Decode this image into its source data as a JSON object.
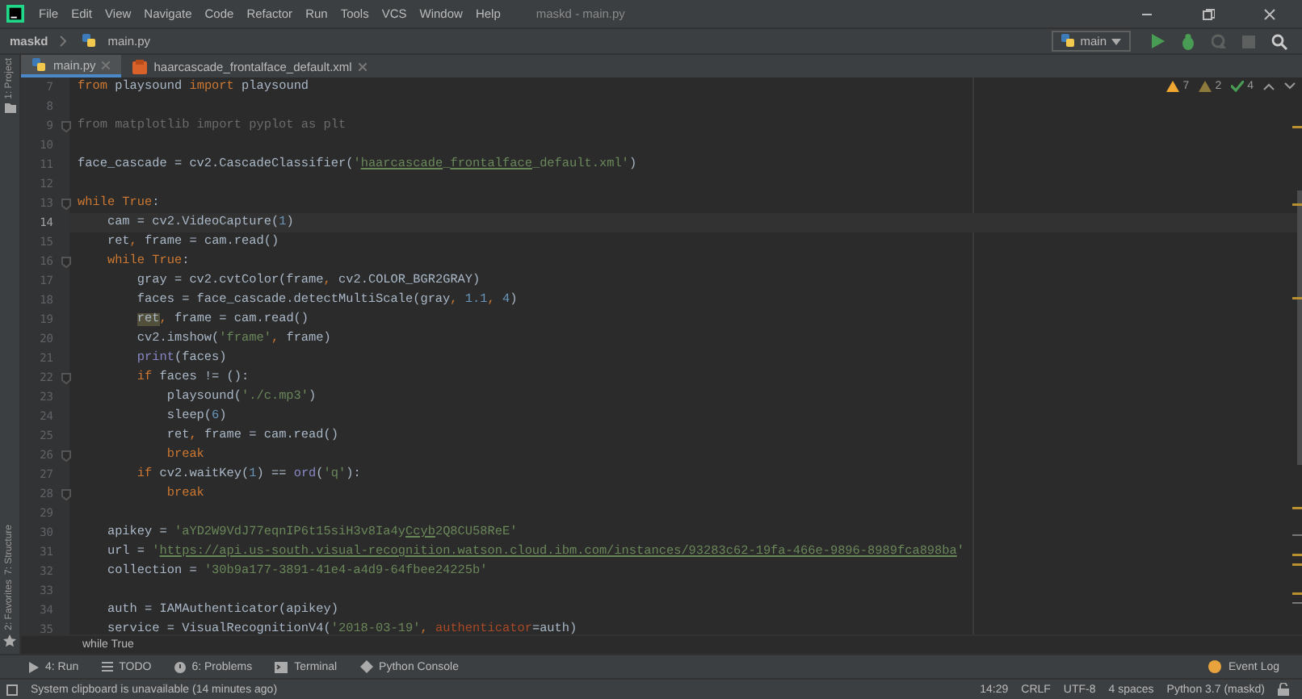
{
  "window": {
    "title": "maskd - main.py",
    "menu": [
      "File",
      "Edit",
      "View",
      "Navigate",
      "Code",
      "Refactor",
      "Run",
      "Tools",
      "VCS",
      "Window",
      "Help"
    ]
  },
  "navbar": {
    "project": "maskd",
    "file": "main.py",
    "run_config": "main"
  },
  "tabs": [
    {
      "label": "main.py",
      "kind": "python",
      "selected": true
    },
    {
      "label": "haarcascade_frontalface_default.xml",
      "kind": "xml",
      "selected": false
    }
  ],
  "side_tools": {
    "top": [
      "1: Project"
    ],
    "bottom": [
      "7: Structure",
      "2: Favorites"
    ]
  },
  "inspections": [
    {
      "kind": "warning",
      "count": "7"
    },
    {
      "kind": "weak",
      "count": "2"
    },
    {
      "kind": "typo",
      "count": "4"
    }
  ],
  "editor": {
    "lines": [
      {
        "number": "7",
        "fold": false,
        "current": false,
        "tokens": [
          {
            "kind": "kw",
            "text": "from"
          },
          {
            "kind": "p",
            "text": " playsound "
          },
          {
            "kind": "kw",
            "text": "import"
          },
          {
            "kind": "p",
            "text": " playsound"
          }
        ]
      },
      {
        "number": "8",
        "fold": false,
        "current": false
      },
      {
        "number": "9",
        "fold": true,
        "current": false,
        "tokens": [
          {
            "kind": "u",
            "text": "from matplotlib import pyplot as plt"
          }
        ]
      },
      {
        "number": "10",
        "fold": false,
        "current": false
      },
      {
        "number": "11",
        "fold": false,
        "current": false,
        "tokens": [
          {
            "kind": "p",
            "text": "face_cascade = cv2.CascadeClassifier("
          },
          {
            "kind": "s",
            "text": "'"
          },
          {
            "kind": "su",
            "text": "haarcascade"
          },
          {
            "kind": "s",
            "text": "_"
          },
          {
            "kind": "su",
            "text": "frontalface"
          },
          {
            "kind": "s",
            "text": "_default.xml'"
          },
          {
            "kind": "p",
            "text": ")"
          }
        ]
      },
      {
        "number": "12",
        "fold": false,
        "current": false
      },
      {
        "number": "13",
        "fold": true,
        "current": false,
        "tokens": [
          {
            "kind": "kw",
            "text": "while True"
          },
          {
            "kind": "p",
            "text": ":"
          }
        ]
      },
      {
        "number": "14",
        "fold": false,
        "current": true,
        "tokens": [
          {
            "kind": "p",
            "text": "    cam = cv2.VideoCapture("
          },
          {
            "kind": "n",
            "text": "1"
          },
          {
            "kind": "p",
            "text": ")"
          }
        ]
      },
      {
        "number": "15",
        "fold": false,
        "current": false,
        "tokens": [
          {
            "kind": "p",
            "text": "    ret"
          },
          {
            "kind": "kw",
            "text": ","
          },
          {
            "kind": "p",
            "text": " frame = cam.read()"
          }
        ]
      },
      {
        "number": "16",
        "fold": true,
        "current": false,
        "tokens": [
          {
            "kind": "kw",
            "text": "    while True"
          },
          {
            "kind": "p",
            "text": ":"
          }
        ]
      },
      {
        "number": "17",
        "fold": false,
        "current": false,
        "tokens": [
          {
            "kind": "p",
            "text": "        gray = cv2.cvtColor(frame"
          },
          {
            "kind": "kw",
            "text": ","
          },
          {
            "kind": "p",
            "text": " cv2.COLOR_BGR2GRAY)"
          }
        ]
      },
      {
        "number": "18",
        "fold": false,
        "current": false,
        "tokens": [
          {
            "kind": "p",
            "text": "        faces = face_cascade.detectMultiScale(gray"
          },
          {
            "kind": "kw",
            "text": ","
          },
          {
            "kind": "n",
            "text": " 1.1"
          },
          {
            "kind": "kw",
            "text": ","
          },
          {
            "kind": "n",
            "text": " 4"
          },
          {
            "kind": "p",
            "text": ")"
          }
        ]
      },
      {
        "number": "19",
        "fold": false,
        "current": false,
        "tokens": [
          {
            "kind": "w",
            "text": "        ret"
          },
          {
            "kind": "kw",
            "text": ","
          },
          {
            "kind": "p",
            "text": " frame = cam.read()"
          }
        ]
      },
      {
        "number": "20",
        "fold": false,
        "current": false,
        "tokens": [
          {
            "kind": "p",
            "text": "        cv2.imshow("
          },
          {
            "kind": "s",
            "text": "'frame'"
          },
          {
            "kind": "kw",
            "text": ","
          },
          {
            "kind": "p",
            "text": " frame)"
          }
        ]
      },
      {
        "number": "21",
        "fold": false,
        "current": false,
        "tokens": [
          {
            "kind": "b",
            "text": "        print"
          },
          {
            "kind": "p",
            "text": "(faces)"
          }
        ]
      },
      {
        "number": "22",
        "fold": true,
        "current": false,
        "tokens": [
          {
            "kind": "kw",
            "text": "        if"
          },
          {
            "kind": "p",
            "text": " faces != ():"
          }
        ]
      },
      {
        "number": "23",
        "fold": false,
        "current": false,
        "tokens": [
          {
            "kind": "p",
            "text": "            playsound("
          },
          {
            "kind": "s",
            "text": "'./c.mp3'"
          },
          {
            "kind": "p",
            "text": ")"
          }
        ]
      },
      {
        "number": "24",
        "fold": false,
        "current": false,
        "tokens": [
          {
            "kind": "p",
            "text": "            sleep("
          },
          {
            "kind": "n",
            "text": "6"
          },
          {
            "kind": "p",
            "text": ")"
          }
        ]
      },
      {
        "number": "25",
        "fold": false,
        "current": false,
        "tokens": [
          {
            "kind": "p",
            "text": "            ret"
          },
          {
            "kind": "kw",
            "text": ","
          },
          {
            "kind": "p",
            "text": " frame = cam.read()"
          }
        ]
      },
      {
        "number": "26",
        "fold": true,
        "current": false,
        "tokens": [
          {
            "kind": "kw",
            "text": "            break"
          }
        ]
      },
      {
        "number": "27",
        "fold": false,
        "current": false,
        "tokens": [
          {
            "kind": "kw",
            "text": "        if"
          },
          {
            "kind": "p",
            "text": " cv2.waitKey("
          },
          {
            "kind": "n",
            "text": "1"
          },
          {
            "kind": "p",
            "text": ") == "
          },
          {
            "kind": "b",
            "text": "ord"
          },
          {
            "kind": "p",
            "text": "("
          },
          {
            "kind": "s",
            "text": "'q'"
          },
          {
            "kind": "p",
            "text": "):"
          }
        ]
      },
      {
        "number": "28",
        "fold": true,
        "current": false,
        "tokens": [
          {
            "kind": "kw",
            "text": "            break"
          }
        ]
      },
      {
        "number": "29",
        "fold": false,
        "current": false
      },
      {
        "number": "30",
        "fold": false,
        "current": false,
        "tokens": [
          {
            "kind": "p",
            "text": "    apikey = "
          },
          {
            "kind": "s",
            "text": "'aYD2W9VdJ77eqnIP6t15siH3v8Ia4y"
          },
          {
            "kind": "su",
            "text": "Ccyb"
          },
          {
            "kind": "s",
            "text": "2Q8CU58ReE'"
          }
        ]
      },
      {
        "number": "31",
        "fold": false,
        "current": false,
        "tokens": [
          {
            "kind": "p",
            "text": "    url = "
          },
          {
            "kind": "s",
            "text": "'"
          },
          {
            "kind": "link",
            "text": "https://api.us-south.visual-recognition.watson.cloud.ibm.com/instances/93283c62-19fa-466e-9896-8989fca898ba"
          },
          {
            "kind": "s",
            "text": "'"
          }
        ]
      },
      {
        "number": "32",
        "fold": false,
        "current": false,
        "tokens": [
          {
            "kind": "p",
            "text": "    collection = "
          },
          {
            "kind": "s",
            "text": "'30b9a177-3891-41e4-a4d9-64fbee24225b'"
          }
        ]
      },
      {
        "number": "33",
        "fold": false,
        "current": false
      },
      {
        "number": "34",
        "fold": false,
        "current": false,
        "tokens": [
          {
            "kind": "p",
            "text": "    auth = IAMAuthenticator(apikey)"
          }
        ]
      },
      {
        "number": "35",
        "fold": false,
        "current": false,
        "tokens": [
          {
            "kind": "p",
            "text": "    service = VisualRecognitionV4("
          },
          {
            "kind": "s",
            "text": "'2018-03-19'"
          },
          {
            "kind": "kw",
            "text": ","
          },
          {
            "kind": "prm",
            "text": " authenticator"
          },
          {
            "kind": "p",
            "text": "=auth)"
          }
        ]
      }
    ]
  },
  "breadcrumb": "while True",
  "tool_windows": [
    {
      "label": "4: Run",
      "kind": "run"
    },
    {
      "label": "TODO",
      "kind": "todo"
    },
    {
      "label": "6: Problems",
      "kind": "problems"
    },
    {
      "label": "Terminal",
      "kind": "terminal"
    },
    {
      "label": "Python Console",
      "kind": "console"
    }
  ],
  "event_log": "Event Log",
  "status": {
    "message": "System clipboard is unavailable (14 minutes ago)",
    "items": [
      "14:29",
      "CRLF",
      "UTF-8",
      "4 spaces",
      "Python 3.7 (maskd)"
    ]
  }
}
